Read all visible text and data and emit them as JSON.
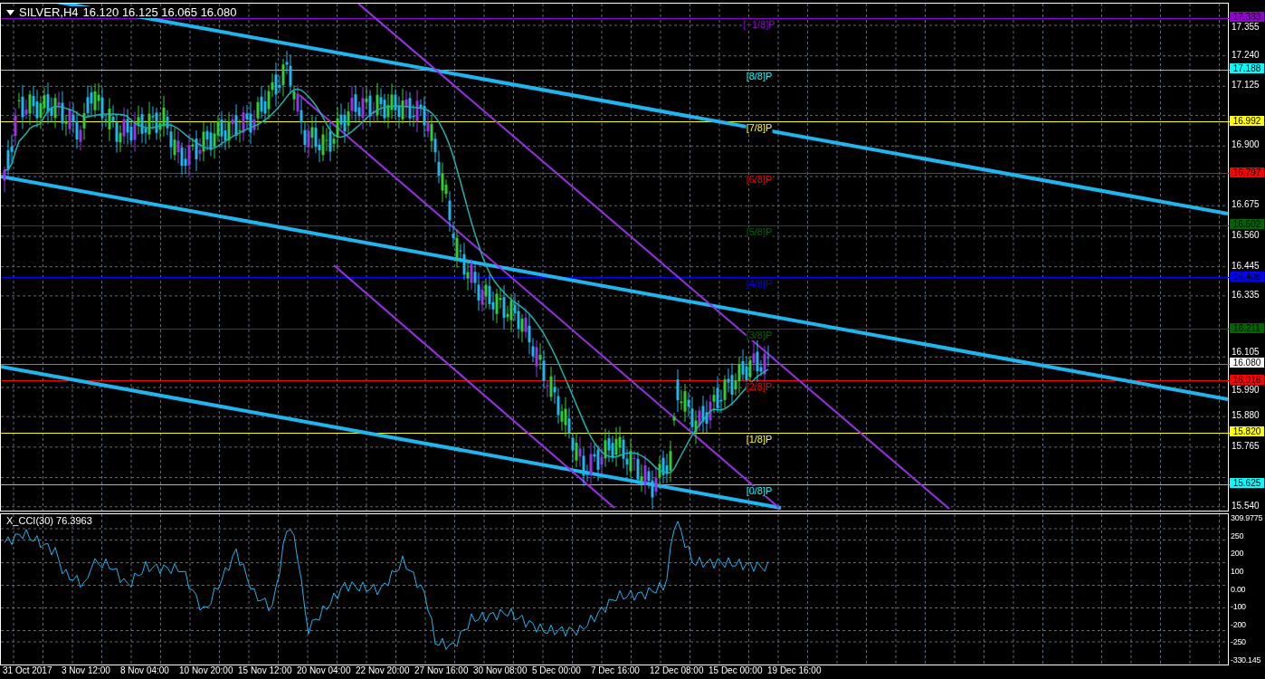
{
  "header": {
    "symbol": "SILVER,H4",
    "quotes": "16.120 16.125 16.065 16.080"
  },
  "price_axis": [
    "17.355",
    "17.240",
    "17.125",
    "16.900",
    "16.675",
    "16.560",
    "16.445",
    "16.335",
    "16.105",
    "15.990",
    "15.880",
    "15.765",
    "15.540"
  ],
  "levels": [
    {
      "kind": "murrey",
      "label": "[+1/8]P",
      "price": "17.383",
      "color": "#9400d3"
    },
    {
      "kind": "murrey",
      "label": "[8/8]P",
      "price": "17.188",
      "color": "#00ffff"
    },
    {
      "kind": "murrey",
      "label": "[7/8]P",
      "price": "16.992",
      "color": "#ffff00"
    },
    {
      "kind": "murrey",
      "label": "[6/8]P",
      "price": "16.797",
      "color": "#ff0000"
    },
    {
      "kind": "murrey",
      "label": "[5/8]P",
      "price": "16.602",
      "color": "#006400"
    },
    {
      "kind": "murrey",
      "label": "[4/8]P",
      "price": "16.406",
      "color": "#0000ff"
    },
    {
      "kind": "murrey",
      "label": "[3/8]P",
      "price": "16.211",
      "color": "#006400"
    },
    {
      "kind": "bid",
      "price": "16.080",
      "color": "#ffffff"
    },
    {
      "kind": "murrey",
      "label": "[2/8]P",
      "price": "16.016",
      "color": "#ff0000"
    },
    {
      "kind": "murrey",
      "label": "[1/8]P",
      "price": "15.820",
      "color": "#ffff00"
    },
    {
      "kind": "murrey",
      "label": "[0/8]P",
      "price": "15.625",
      "color": "#00ffff"
    }
  ],
  "indicator": {
    "title": "X_CCI(30) 76.3963",
    "axis": [
      "309.9775",
      "250",
      "200",
      "100",
      "0.00",
      "-100",
      "-200",
      "-250",
      "-330.145"
    ]
  },
  "time_axis": [
    "31 Oct 2017",
    "3 Nov 12:00",
    "8 Nov 04:00",
    "10 Nov 20:00",
    "15 Nov 12:00",
    "20 Nov 04:00",
    "22 Nov 20:00",
    "27 Nov 16:00",
    "30 Nov 08:00",
    "5 Dec 00:00",
    "7 Dec 16:00",
    "12 Dec 08:00",
    "15 Dec 00:00",
    "19 Dec 16:00"
  ]
}
